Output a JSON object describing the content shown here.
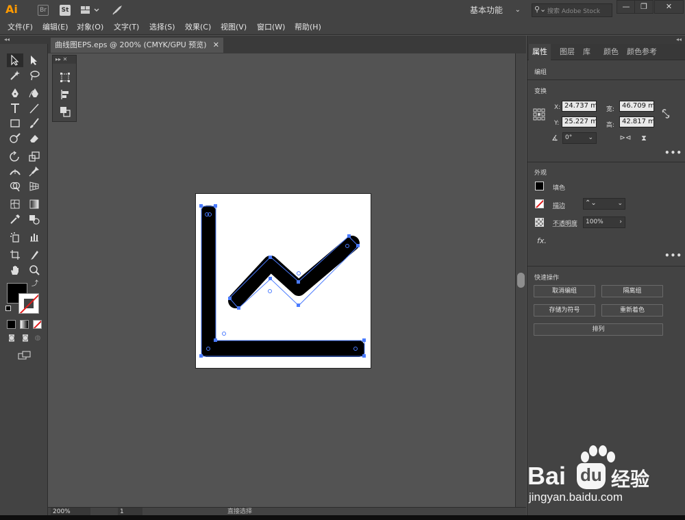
{
  "app": {
    "logo": "Ai",
    "bridge_icon": "Br",
    "stock_icon": "St",
    "workspace": "基本功能",
    "search_placeholder": "搜索 Adobe Stock",
    "window_buttons": [
      "—",
      "❐",
      "✕"
    ]
  },
  "menu": [
    "文件(F)",
    "编辑(E)",
    "对象(O)",
    "文字(T)",
    "选择(S)",
    "效果(C)",
    "视图(V)",
    "窗口(W)",
    "帮助(H)"
  ],
  "document": {
    "tab_title": "曲线图EPS.eps @ 200% (CMYK/GPU 预览)",
    "close": "✕"
  },
  "toolbar": {
    "collapse": "◂◂",
    "tools": [
      "selection-tool",
      "direct-selection-tool",
      "magic-wand-tool",
      "lasso-tool",
      "pen-tool",
      "curvature-tool",
      "type-tool",
      "line-segment-tool",
      "rectangle-tool",
      "paintbrush-tool",
      "shaper-tool",
      "eraser-tool",
      "rotate-tool",
      "scale-tool",
      "width-tool",
      "puppet-warp-tool",
      "shape-builder-tool",
      "perspective-grid-tool",
      "mesh-tool",
      "gradient-tool",
      "eyedropper-tool",
      "blend-tool",
      "symbol-sprayer-tool",
      "column-graph-tool",
      "artboard-tool",
      "slice-tool",
      "hand-tool",
      "zoom-tool"
    ]
  },
  "properties": {
    "panel_top": "◂◂",
    "tabs": [
      "属性",
      "图层",
      "库",
      "颜色",
      "颜色参考"
    ],
    "active_tab": "属性",
    "selection_type": "编组",
    "transform": {
      "section": "变换",
      "x_label": "X:",
      "x": "24.737 m",
      "y_label": "Y:",
      "y": "25.227 m",
      "w_label": "宽:",
      "w": "46.709 m",
      "h_label": "高:",
      "h": "42.817 m",
      "angle": "0°"
    },
    "appearance": {
      "section": "外观",
      "fill_label": "填色",
      "stroke_label": "描边",
      "opacity_label": "不透明度",
      "opacity": "100%",
      "fx": "fx."
    },
    "quick_actions": {
      "section": "快速操作",
      "ungroup": "取消编组",
      "isolate": "隔离组",
      "save_symbol": "存储为符号",
      "recolor": "重新着色",
      "arrange": "排列"
    },
    "more": "•••"
  },
  "status": {
    "zoom": "200%",
    "page": "1",
    "tool_name": "直接选择"
  },
  "watermark": {
    "brand": "Bai",
    "brand_cn": "经验",
    "url": "jingyan.baidu.com"
  },
  "colors": {
    "accent_ai": "#ff9a00",
    "selection": "#4a7bff",
    "stroke_none": "#e21c1c"
  }
}
